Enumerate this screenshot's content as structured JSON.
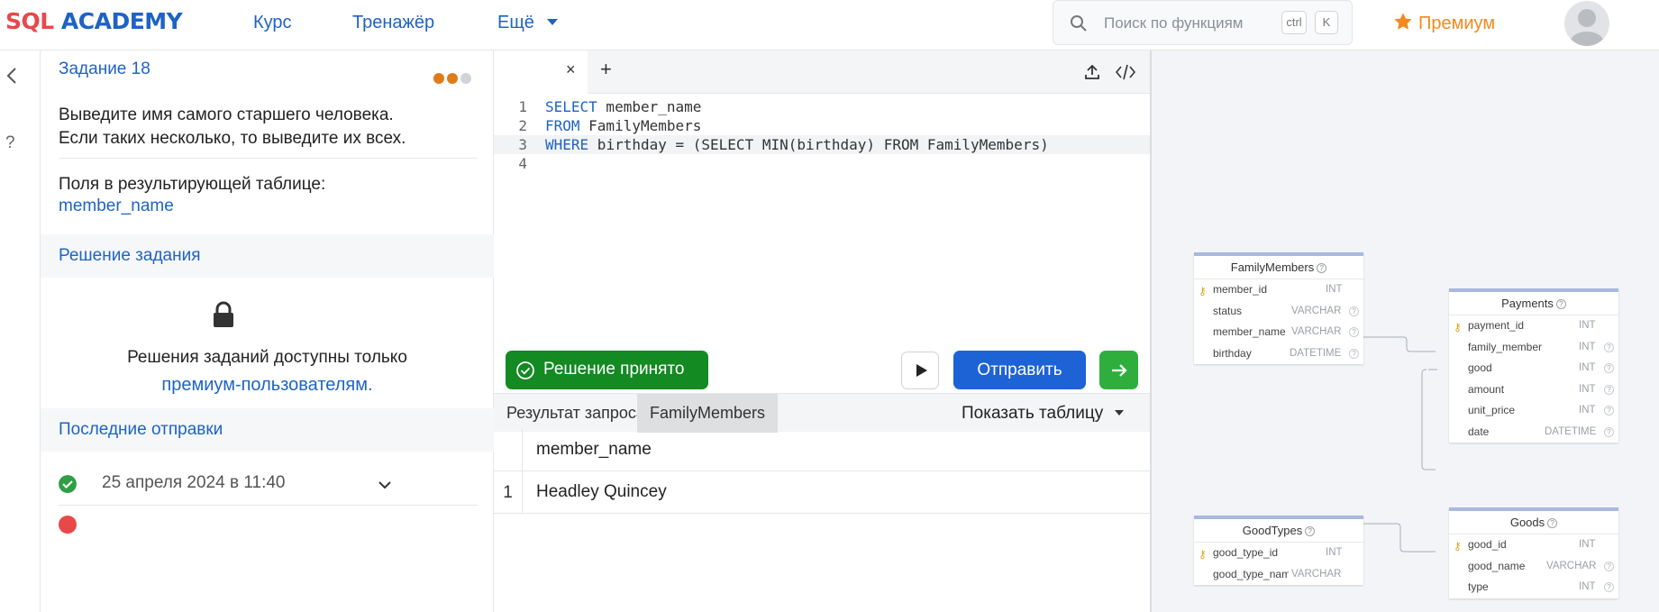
{
  "header": {
    "logo_sql": "SQL",
    "logo_academy": "ACADEMY",
    "nav": [
      "Курс",
      "Тренажёр",
      "Ещё"
    ],
    "search_placeholder": "Поиск по функциям",
    "kbd_ctrl": "ctrl",
    "kbd_k": "K",
    "premium_label": "Премиум"
  },
  "task": {
    "title": "Задание 18",
    "text_line1": "Выведите имя самого старшего человека.",
    "text_line2": "Если таких несколько, то выведите их всех.",
    "fields_label": "Поля в результирующей таблице:",
    "fields_value": "member_name",
    "solution_header": "Решение задания",
    "lock_line1": "Решения заданий доступны только",
    "lock_line2": "премиум-пользователям.",
    "recent_header": "Последние отправки",
    "submission_date": "25 апреля 2024 в 11:40",
    "difficulty_colors": [
      "#e07b1a",
      "#e07b1a",
      "#d0d3d8"
    ]
  },
  "editor": {
    "lines": [
      {
        "num": "1",
        "kw": "SELECT",
        "rest": " member_name"
      },
      {
        "num": "2",
        "kw": "FROM",
        "rest": " FamilyMembers"
      },
      {
        "num": "3",
        "kw": "WHERE",
        "rest": " birthday = (SELECT MIN(birthday) FROM FamilyMembers)"
      },
      {
        "num": "4",
        "kw": "",
        "rest": ""
      }
    ],
    "accepted_label": "Решение принято",
    "send_label": "Отправить",
    "tab_close": "×",
    "tab_add": "+"
  },
  "results": {
    "tabs": [
      "Результат запроса",
      "FamilyMembers"
    ],
    "show_table_label": "Показать таблицу",
    "column": "member_name",
    "rows": [
      {
        "idx": "1",
        "value": "Headley Quincey"
      }
    ]
  },
  "schema": {
    "family_members": {
      "title": "FamilyMembers",
      "fields": [
        {
          "name": "member_id",
          "type": "INT"
        },
        {
          "name": "status",
          "type": "VARCHAR"
        },
        {
          "name": "member_name",
          "type": "VARCHAR"
        },
        {
          "name": "birthday",
          "type": "DATETIME"
        }
      ]
    },
    "payments": {
      "title": "Payments",
      "fields": [
        {
          "name": "payment_id",
          "type": "INT"
        },
        {
          "name": "family_member",
          "type": "INT"
        },
        {
          "name": "good",
          "type": "INT"
        },
        {
          "name": "amount",
          "type": "INT"
        },
        {
          "name": "unit_price",
          "type": "INT"
        },
        {
          "name": "date",
          "type": "DATETIME"
        }
      ]
    },
    "good_types": {
      "title": "GoodTypes",
      "fields": [
        {
          "name": "good_type_id",
          "type": "INT"
        },
        {
          "name": "good_type_name",
          "type": "VARCHAR"
        }
      ]
    },
    "goods": {
      "title": "Goods",
      "fields": [
        {
          "name": "good_id",
          "type": "INT"
        },
        {
          "name": "good_name",
          "type": "VARCHAR"
        },
        {
          "name": "type",
          "type": "INT"
        }
      ]
    }
  },
  "colors": {
    "brand_blue": "#1e63c4",
    "brand_red": "#e8484a",
    "accepted_green": "#138a22",
    "premium_orange": "#f28a1d"
  }
}
